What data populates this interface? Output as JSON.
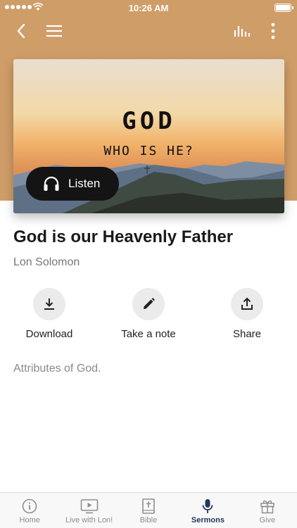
{
  "status_bar": {
    "time": "10:26 AM"
  },
  "artwork": {
    "title": "GOD",
    "subtitle": "WHO IS HE?",
    "listen_label": "Listen"
  },
  "sermon": {
    "title": "God is our Heavenly Father",
    "speaker": "Lon Solomon",
    "description": "Attributes of God."
  },
  "actions": [
    {
      "label": "Download",
      "icon": "download-icon"
    },
    {
      "label": "Take a note",
      "icon": "pencil-icon"
    },
    {
      "label": "Share",
      "icon": "share-icon"
    }
  ],
  "tabs": [
    {
      "label": "Home",
      "icon": "info-icon",
      "active": false
    },
    {
      "label": "Live with Lon!",
      "icon": "tv-play-icon",
      "active": false
    },
    {
      "label": "Bible",
      "icon": "bible-icon",
      "active": false
    },
    {
      "label": "Sermons",
      "icon": "microphone-icon",
      "active": true
    },
    {
      "label": "Give",
      "icon": "gift-icon",
      "active": false
    }
  ],
  "colors": {
    "header": "#cf9d68",
    "active_tab": "#22375a",
    "listen_button": "#141414"
  }
}
